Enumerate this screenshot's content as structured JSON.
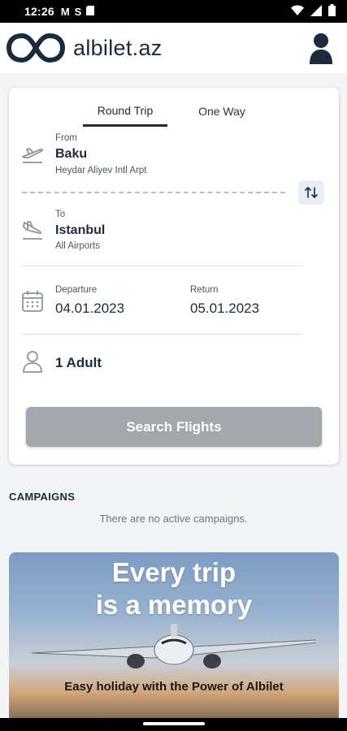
{
  "status_bar": {
    "time": "12:26",
    "notification_icons": [
      "gmail-icon",
      "s-icon",
      "sd-card-icon"
    ],
    "system_icons": [
      "wifi-icon",
      "signal-icon",
      "battery-icon"
    ]
  },
  "header": {
    "brand": "albilet.az",
    "profile_icon": "user-icon"
  },
  "search": {
    "tabs": [
      {
        "label": "Round Trip",
        "active": true
      },
      {
        "label": "One Way",
        "active": false
      }
    ],
    "from": {
      "label": "From",
      "city": "Baku",
      "airport": "Heydar Aliyev Intl Arpt"
    },
    "to": {
      "label": "To",
      "city": "Istanbul",
      "airport": "All Airports"
    },
    "departure": {
      "label": "Departure",
      "date": "04.01.2023"
    },
    "return": {
      "label": "Return",
      "date": "05.01.2023"
    },
    "passengers": "1 Adult",
    "search_label": "Search Flights"
  },
  "campaigns": {
    "title": "CAMPAIGNS",
    "empty_text": "There are no active campaigns."
  },
  "banner": {
    "line1": "Every trip",
    "line2": "is a memory",
    "subtitle": "Easy holiday with the Power of Albilet"
  },
  "colors": {
    "brand_navy": "#1b2a3d",
    "button_disabled": "#a3a6aa",
    "swap_bg": "#e8edf6"
  }
}
